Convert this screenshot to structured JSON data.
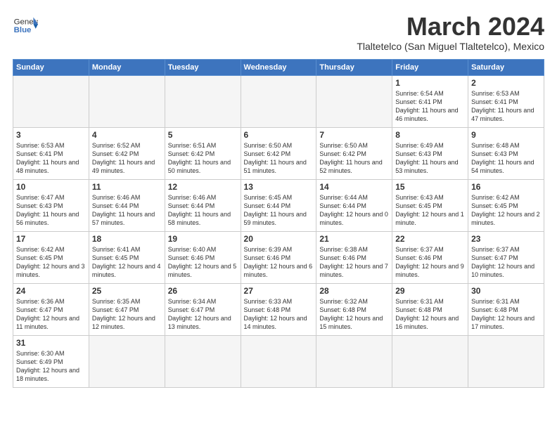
{
  "header": {
    "logo_general": "General",
    "logo_blue": "Blue",
    "month_title": "March 2024",
    "location": "Tlaltetelco (San Miguel Tlaltetelco), Mexico"
  },
  "weekdays": [
    "Sunday",
    "Monday",
    "Tuesday",
    "Wednesday",
    "Thursday",
    "Friday",
    "Saturday"
  ],
  "weeks": [
    [
      {
        "day": "",
        "empty": true
      },
      {
        "day": "",
        "empty": true
      },
      {
        "day": "",
        "empty": true
      },
      {
        "day": "",
        "empty": true
      },
      {
        "day": "",
        "empty": true
      },
      {
        "day": "1",
        "sunrise": "6:54 AM",
        "sunset": "6:41 PM",
        "daylight": "11 hours and 46 minutes."
      },
      {
        "day": "2",
        "sunrise": "6:53 AM",
        "sunset": "6:41 PM",
        "daylight": "11 hours and 47 minutes."
      }
    ],
    [
      {
        "day": "3",
        "sunrise": "6:53 AM",
        "sunset": "6:41 PM",
        "daylight": "11 hours and 48 minutes."
      },
      {
        "day": "4",
        "sunrise": "6:52 AM",
        "sunset": "6:42 PM",
        "daylight": "11 hours and 49 minutes."
      },
      {
        "day": "5",
        "sunrise": "6:51 AM",
        "sunset": "6:42 PM",
        "daylight": "11 hours and 50 minutes."
      },
      {
        "day": "6",
        "sunrise": "6:50 AM",
        "sunset": "6:42 PM",
        "daylight": "11 hours and 51 minutes."
      },
      {
        "day": "7",
        "sunrise": "6:50 AM",
        "sunset": "6:42 PM",
        "daylight": "11 hours and 52 minutes."
      },
      {
        "day": "8",
        "sunrise": "6:49 AM",
        "sunset": "6:43 PM",
        "daylight": "11 hours and 53 minutes."
      },
      {
        "day": "9",
        "sunrise": "6:48 AM",
        "sunset": "6:43 PM",
        "daylight": "11 hours and 54 minutes."
      }
    ],
    [
      {
        "day": "10",
        "sunrise": "6:47 AM",
        "sunset": "6:43 PM",
        "daylight": "11 hours and 56 minutes."
      },
      {
        "day": "11",
        "sunrise": "6:46 AM",
        "sunset": "6:44 PM",
        "daylight": "11 hours and 57 minutes."
      },
      {
        "day": "12",
        "sunrise": "6:46 AM",
        "sunset": "6:44 PM",
        "daylight": "11 hours and 58 minutes."
      },
      {
        "day": "13",
        "sunrise": "6:45 AM",
        "sunset": "6:44 PM",
        "daylight": "11 hours and 59 minutes."
      },
      {
        "day": "14",
        "sunrise": "6:44 AM",
        "sunset": "6:44 PM",
        "daylight": "12 hours and 0 minutes."
      },
      {
        "day": "15",
        "sunrise": "6:43 AM",
        "sunset": "6:45 PM",
        "daylight": "12 hours and 1 minute."
      },
      {
        "day": "16",
        "sunrise": "6:42 AM",
        "sunset": "6:45 PM",
        "daylight": "12 hours and 2 minutes."
      }
    ],
    [
      {
        "day": "17",
        "sunrise": "6:42 AM",
        "sunset": "6:45 PM",
        "daylight": "12 hours and 3 minutes."
      },
      {
        "day": "18",
        "sunrise": "6:41 AM",
        "sunset": "6:45 PM",
        "daylight": "12 hours and 4 minutes."
      },
      {
        "day": "19",
        "sunrise": "6:40 AM",
        "sunset": "6:46 PM",
        "daylight": "12 hours and 5 minutes."
      },
      {
        "day": "20",
        "sunrise": "6:39 AM",
        "sunset": "6:46 PM",
        "daylight": "12 hours and 6 minutes."
      },
      {
        "day": "21",
        "sunrise": "6:38 AM",
        "sunset": "6:46 PM",
        "daylight": "12 hours and 7 minutes."
      },
      {
        "day": "22",
        "sunrise": "6:37 AM",
        "sunset": "6:46 PM",
        "daylight": "12 hours and 9 minutes."
      },
      {
        "day": "23",
        "sunrise": "6:37 AM",
        "sunset": "6:47 PM",
        "daylight": "12 hours and 10 minutes."
      }
    ],
    [
      {
        "day": "24",
        "sunrise": "6:36 AM",
        "sunset": "6:47 PM",
        "daylight": "12 hours and 11 minutes."
      },
      {
        "day": "25",
        "sunrise": "6:35 AM",
        "sunset": "6:47 PM",
        "daylight": "12 hours and 12 minutes."
      },
      {
        "day": "26",
        "sunrise": "6:34 AM",
        "sunset": "6:47 PM",
        "daylight": "12 hours and 13 minutes."
      },
      {
        "day": "27",
        "sunrise": "6:33 AM",
        "sunset": "6:48 PM",
        "daylight": "12 hours and 14 minutes."
      },
      {
        "day": "28",
        "sunrise": "6:32 AM",
        "sunset": "6:48 PM",
        "daylight": "12 hours and 15 minutes."
      },
      {
        "day": "29",
        "sunrise": "6:31 AM",
        "sunset": "6:48 PM",
        "daylight": "12 hours and 16 minutes."
      },
      {
        "day": "30",
        "sunrise": "6:31 AM",
        "sunset": "6:48 PM",
        "daylight": "12 hours and 17 minutes."
      }
    ],
    [
      {
        "day": "31",
        "sunrise": "6:30 AM",
        "sunset": "6:49 PM",
        "daylight": "12 hours and 18 minutes."
      },
      {
        "day": "",
        "empty": true
      },
      {
        "day": "",
        "empty": true
      },
      {
        "day": "",
        "empty": true
      },
      {
        "day": "",
        "empty": true
      },
      {
        "day": "",
        "empty": true
      },
      {
        "day": "",
        "empty": true
      }
    ]
  ]
}
